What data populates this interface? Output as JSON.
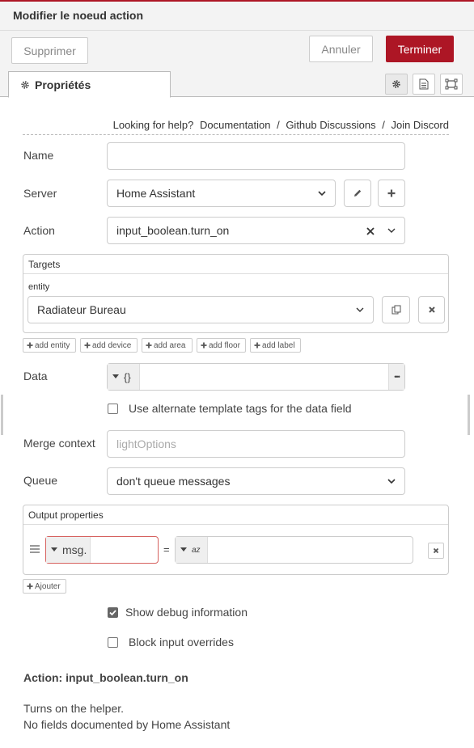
{
  "header": {
    "title": "Modifier le noeud action"
  },
  "toolbar": {
    "delete_label": "Supprimer",
    "cancel_label": "Annuler",
    "done_label": "Terminer"
  },
  "tabs": {
    "properties_label": "Propriétés"
  },
  "help": {
    "prefix": "Looking for help?",
    "links": [
      "Documentation",
      "Github Discussions",
      "Join Discord"
    ],
    "separator": "/"
  },
  "form": {
    "name": {
      "label": "Name",
      "value": ""
    },
    "server": {
      "label": "Server",
      "value": "Home Assistant"
    },
    "action": {
      "label": "Action",
      "value": "input_boolean.turn_on"
    },
    "targets": {
      "title": "Targets",
      "entity_label": "entity",
      "entity_value": "Radiateur Bureau",
      "add_buttons": [
        "add entity",
        "add device",
        "add area",
        "add floor",
        "add label"
      ]
    },
    "data": {
      "label": "Data",
      "type_glyph": "{}",
      "more_glyph": "•••"
    },
    "alt_template": {
      "label": "Use alternate template tags for the data field",
      "checked": false
    },
    "merge_context": {
      "label": "Merge context",
      "placeholder": "lightOptions"
    },
    "queue": {
      "label": "Queue",
      "value": "don't queue messages"
    },
    "output": {
      "title": "Output properties",
      "left_value": "msg.",
      "equals": "=",
      "right_type_glyph": "az",
      "add_label": "Ajouter"
    },
    "show_debug": {
      "label": "Show debug information",
      "checked": true
    },
    "block_input": {
      "label": "Block input overrides",
      "checked": false
    }
  },
  "info": {
    "title": "Action: input_boolean.turn_on",
    "line1": "Turns on the helper.",
    "line2": "No fields documented by Home Assistant"
  },
  "colors": {
    "primary": "#ad1625",
    "invalid_border": "#d6615f"
  }
}
